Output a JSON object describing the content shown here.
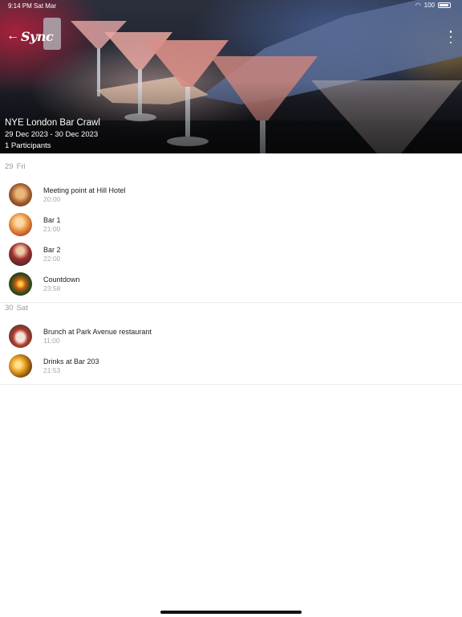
{
  "status_bar": {
    "time": "9:14 PM",
    "date": "Sat Mar",
    "battery": "100"
  },
  "header": {
    "back_icon": "arrow-left-icon",
    "logo_text": "Sync",
    "menu_icon": "vertical-ellipsis-icon"
  },
  "event": {
    "title": "NYE London Bar Crawl",
    "dates": "29 Dec 2023 - 30 Dec 2023",
    "participants": "1 Participants"
  },
  "days": [
    {
      "day_number": "29",
      "day_name": "Fri",
      "items": [
        {
          "title": "Meeting point at Hill Hotel",
          "time": "20:00"
        },
        {
          "title": "Bar 1",
          "time": "21:00"
        },
        {
          "title": "Bar 2",
          "time": "22:00"
        },
        {
          "title": "Countdown",
          "time": "23:58"
        }
      ]
    },
    {
      "day_number": "30",
      "day_name": "Sat",
      "items": [
        {
          "title": "Brunch at Park Avenue restaurant",
          "time": "11:00"
        },
        {
          "title": "Drinks at Bar 203",
          "time": "21:53"
        }
      ]
    }
  ]
}
